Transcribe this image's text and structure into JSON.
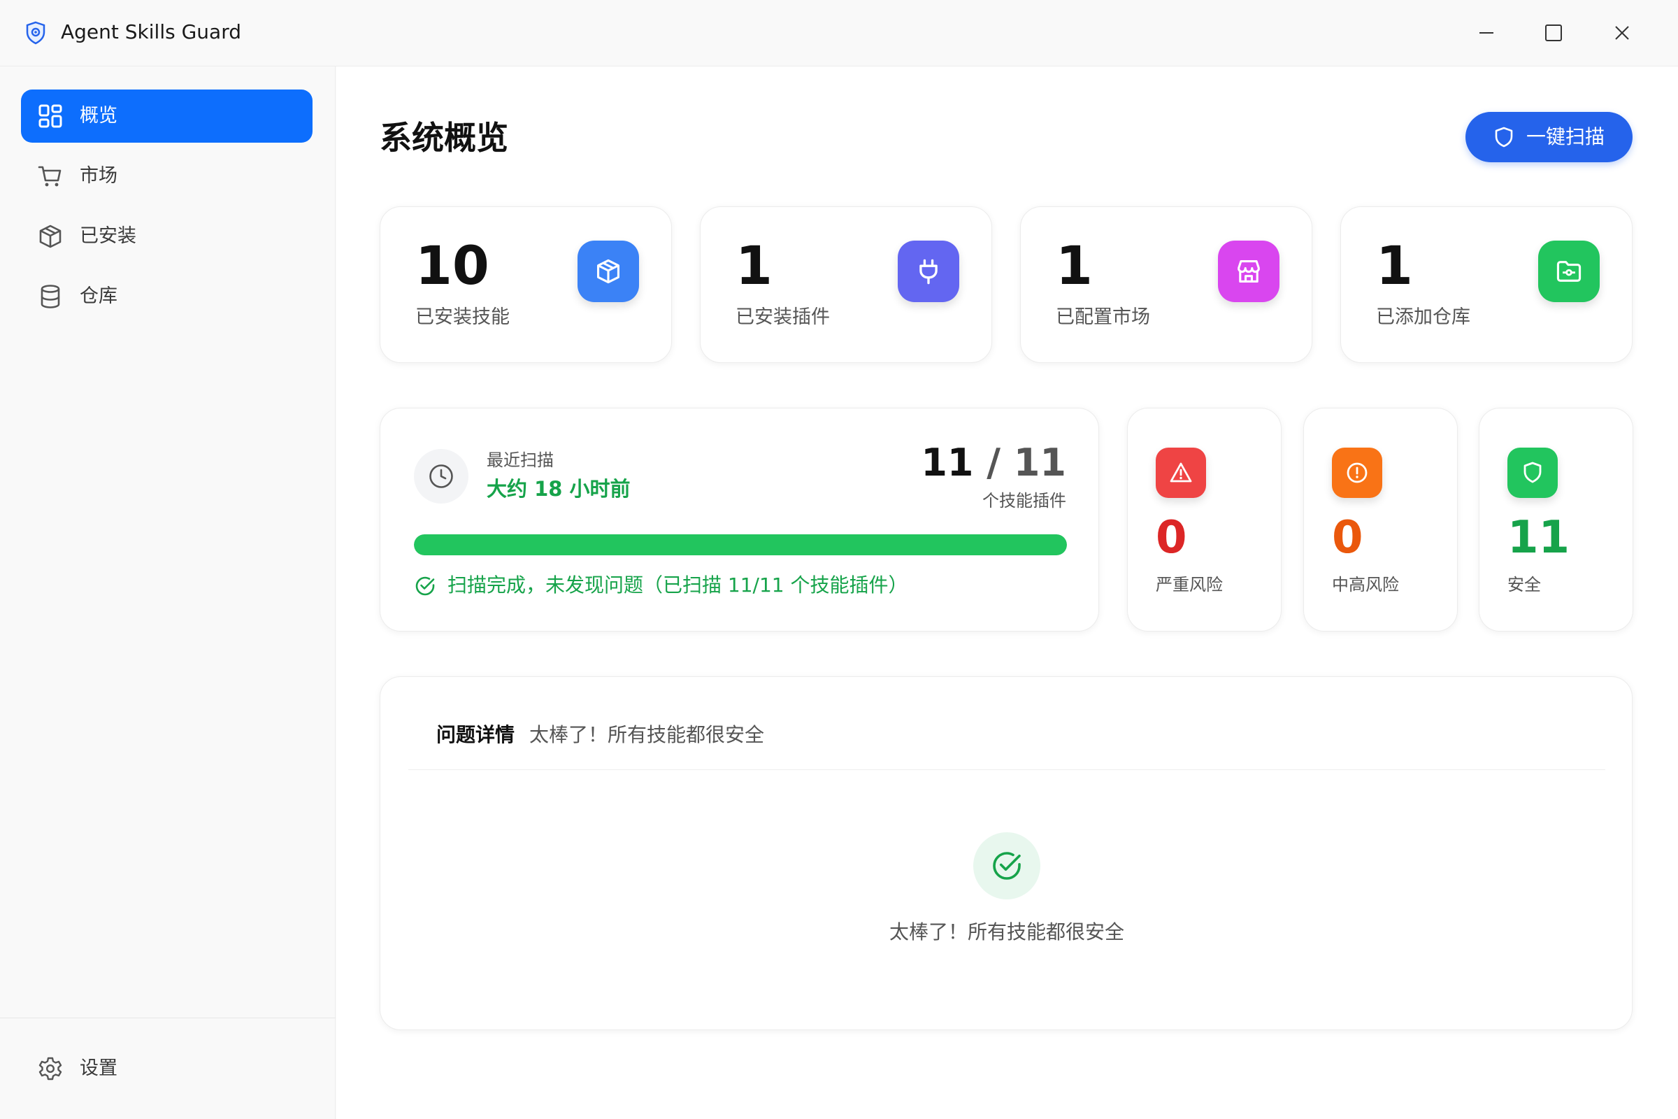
{
  "window": {
    "title": "Agent Skills Guard",
    "controls": [
      "minimize-icon",
      "maximize-icon",
      "close-icon"
    ]
  },
  "sidebar": {
    "items": [
      {
        "label": "概览",
        "icon": "grid-icon",
        "active": true
      },
      {
        "label": "市场",
        "icon": "cart-icon",
        "active": false
      },
      {
        "label": "已安装",
        "icon": "package-icon",
        "active": false
      },
      {
        "label": "仓库",
        "icon": "database-icon",
        "active": false
      }
    ],
    "settings": {
      "label": "设置",
      "icon": "gear-icon"
    }
  },
  "main": {
    "title": "系统概览",
    "scan_button": {
      "label": "一键扫描",
      "icon": "shield-icon"
    },
    "stats": [
      {
        "value": "10",
        "label": "已安装技能",
        "icon": "package-icon",
        "color": "#3b82f6"
      },
      {
        "value": "1",
        "label": "已安装插件",
        "icon": "plug-icon",
        "color": "#6366f1"
      },
      {
        "value": "1",
        "label": "已配置市场",
        "icon": "store-icon",
        "color": "#d946ef"
      },
      {
        "value": "1",
        "label": "已添加仓库",
        "icon": "folder-icon",
        "color": "#22c55e"
      }
    ],
    "scan": {
      "recent_label": "最近扫描",
      "recent_value": "大约 18 小时前",
      "scanned": "11",
      "separator": "/",
      "total": "11",
      "unit": "个技能插件",
      "progress": 1.0,
      "status": "扫描完成，未发现问题（已扫描 11/11 个技能插件）",
      "status_color": "#16a34a"
    },
    "risks": [
      {
        "value": "0",
        "label": "严重风险",
        "icon": "warning-triangle-icon",
        "color": "#ef4444",
        "num_color": "#dc2626"
      },
      {
        "value": "0",
        "label": "中高风险",
        "icon": "alert-circle-icon",
        "color": "#f97316",
        "num_color": "#ea580c"
      },
      {
        "value": "11",
        "label": "安全",
        "icon": "shield-icon",
        "color": "#22c55e",
        "num_color": "#16a34a"
      }
    ],
    "issues": {
      "title": "问题详情",
      "subtitle": "太棒了！所有技能都很安全",
      "empty_text": "太棒了！所有技能都很安全"
    }
  },
  "colors": {
    "accent": "#0d6efd",
    "scan_button": "#2563eb",
    "success": "#22c55e"
  }
}
